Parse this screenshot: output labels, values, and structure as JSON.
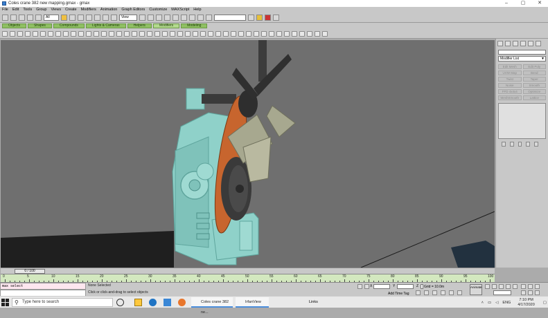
{
  "window": {
    "title": "Coles crane 382 new mapping.gmax - gmax",
    "controls": [
      "–",
      "▢",
      "✕"
    ]
  },
  "menu": [
    "File",
    "Edit",
    "Tools",
    "Group",
    "Views",
    "Create",
    "Modifiers",
    "Animation",
    "Graph Editors",
    "Customize",
    "MAXScript",
    "Help"
  ],
  "toolbar": {
    "selection_filter": "All",
    "reference_coord": "View"
  },
  "tabs": [
    "Objects",
    "Shapes",
    "Compounds",
    "Lights & Cameras",
    "Helpers",
    "Modifiers",
    "Modeling"
  ],
  "active_tab": "Modifiers",
  "command_panel": {
    "modifier_list": "Modifier List",
    "modifier_buttons": [
      "Edit Mesh",
      "Edit Poly",
      "UVW Map",
      "Bend",
      "Twist",
      "Taper",
      "Noise",
      "Smooth",
      "FFD 4x4x4",
      "Optimize",
      "MeshSmooth",
      "Lattice"
    ]
  },
  "timeline": {
    "slider_label": "0 / 100",
    "ticks": [
      0,
      5,
      10,
      15,
      20,
      25,
      30,
      35,
      40,
      45,
      50,
      55,
      60,
      65,
      70,
      75,
      80,
      85,
      90,
      95,
      100
    ]
  },
  "status": {
    "listener_line1": "max select",
    "listener_line2": "",
    "selection_text": "None Selected",
    "prompt_text": "Click or click-and-drag to select objects",
    "x_label": "X",
    "y_label": "Y",
    "z_label": "Z",
    "grid_text": "Grid = 10.0m",
    "add_time_tag": "Add Time Tag",
    "animate": "Animate"
  },
  "taskbar": {
    "search_placeholder": "Type here to search",
    "tasks": [
      "Coles crane 382 ne...",
      "IrfanView"
    ],
    "tray_links": "Links",
    "language": "ENG",
    "time": "7:10 PM",
    "date": "4/17/2020"
  },
  "colors": {
    "viewport_bg": "#6f6f6f",
    "machine_body": "#8fd1c9",
    "belt": "#c7652e",
    "accent_tab": "#8fbf63"
  }
}
